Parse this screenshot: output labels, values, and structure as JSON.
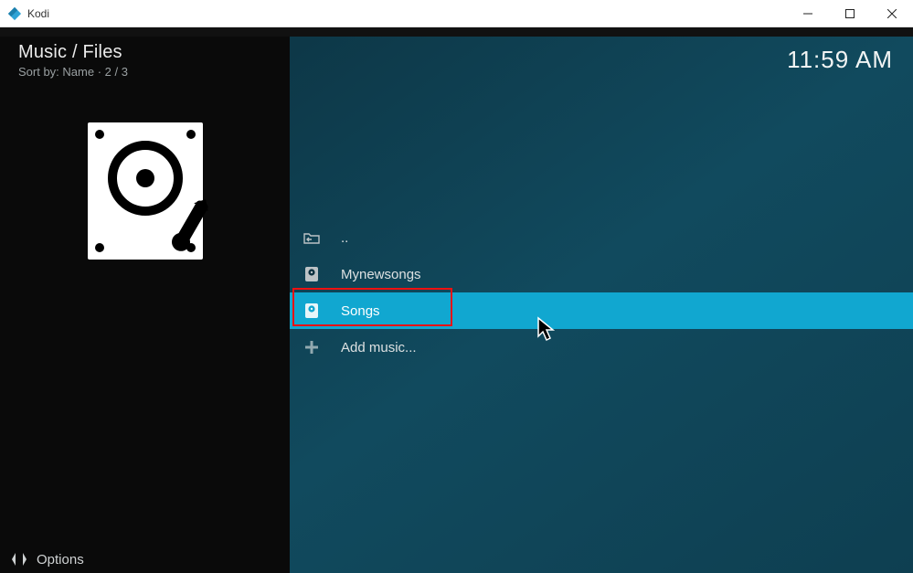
{
  "window": {
    "title": "Kodi"
  },
  "header": {
    "location": "Music / Files",
    "sort_label": "Sort by: Name",
    "position": "2 / 3",
    "subinfo": "Sort by: Name  ·  2 / 3"
  },
  "clock": "11:59 AM",
  "list": {
    "items": [
      {
        "icon": "folder-back-icon",
        "label": "..",
        "selected": false
      },
      {
        "icon": "music-source-icon",
        "label": "Mynewsongs",
        "selected": false
      },
      {
        "icon": "music-source-icon",
        "label": "Songs",
        "selected": true
      },
      {
        "icon": "plus-icon",
        "label": "Add music...",
        "selected": false
      }
    ]
  },
  "footer": {
    "options_label": "Options"
  }
}
